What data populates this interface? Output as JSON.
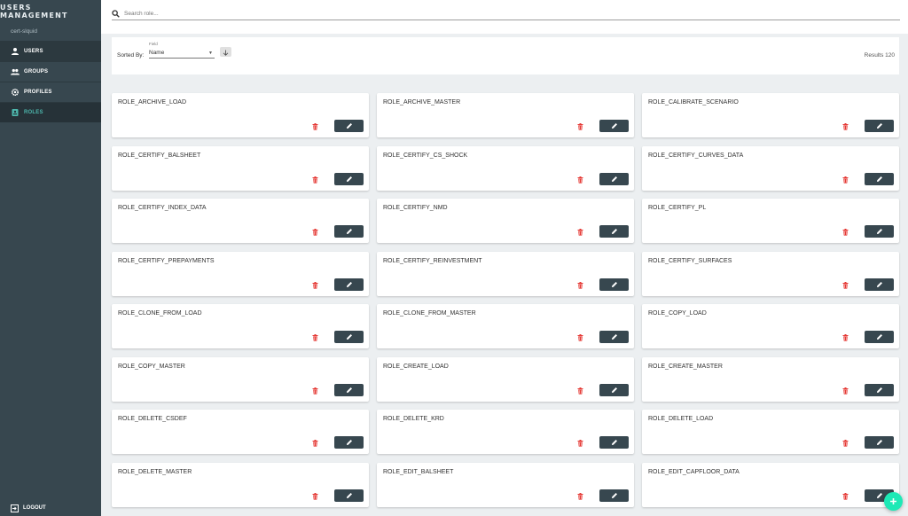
{
  "app": {
    "title": "USERS MANAGEMENT",
    "subtitle": "cert-slquid"
  },
  "sidebar": {
    "items": [
      {
        "label": "USERS",
        "icon": "person-icon"
      },
      {
        "label": "GROUPS",
        "icon": "group-icon"
      },
      {
        "label": "PROFILES",
        "icon": "gear-icon"
      },
      {
        "label": "ROLES",
        "icon": "badge-icon",
        "active": true
      }
    ],
    "logout_label": "LOGOUT"
  },
  "search": {
    "placeholder": "Search role...",
    "value": ""
  },
  "sort": {
    "label": "Sorted By:",
    "field_caption": "Field",
    "field_value": "Name",
    "direction": "descending-arrow-icon"
  },
  "results_label": "Results 120",
  "roles": [
    "ROLE_ARCHIVE_LOAD",
    "ROLE_ARCHIVE_MASTER",
    "ROLE_CALIBRATE_SCENARIO",
    "ROLE_CERTIFY_BALSHEET",
    "ROLE_CERTIFY_CS_SHOCK",
    "ROLE_CERTIFY_CURVES_DATA",
    "ROLE_CERTIFY_INDEX_DATA",
    "ROLE_CERTIFY_NMD",
    "ROLE_CERTIFY_PL",
    "ROLE_CERTIFY_PREPAYMENTS",
    "ROLE_CERTIFY_REINVESTMENT",
    "ROLE_CERTIFY_SURFACES",
    "ROLE_CLONE_FROM_LOAD",
    "ROLE_CLONE_FROM_MASTER",
    "ROLE_COPY_LOAD",
    "ROLE_COPY_MASTER",
    "ROLE_CREATE_LOAD",
    "ROLE_CREATE_MASTER",
    "ROLE_DELETE_CSDEF",
    "ROLE_DELETE_KRD",
    "ROLE_DELETE_LOAD",
    "ROLE_DELETE_MASTER",
    "ROLE_EDIT_BALSHEET",
    "ROLE_EDIT_CAPFLOOR_DATA"
  ],
  "colors": {
    "sidebar": "#37474f",
    "accent": "#4db6ac",
    "delete": "#e53935",
    "fab": "#1de9b6"
  }
}
